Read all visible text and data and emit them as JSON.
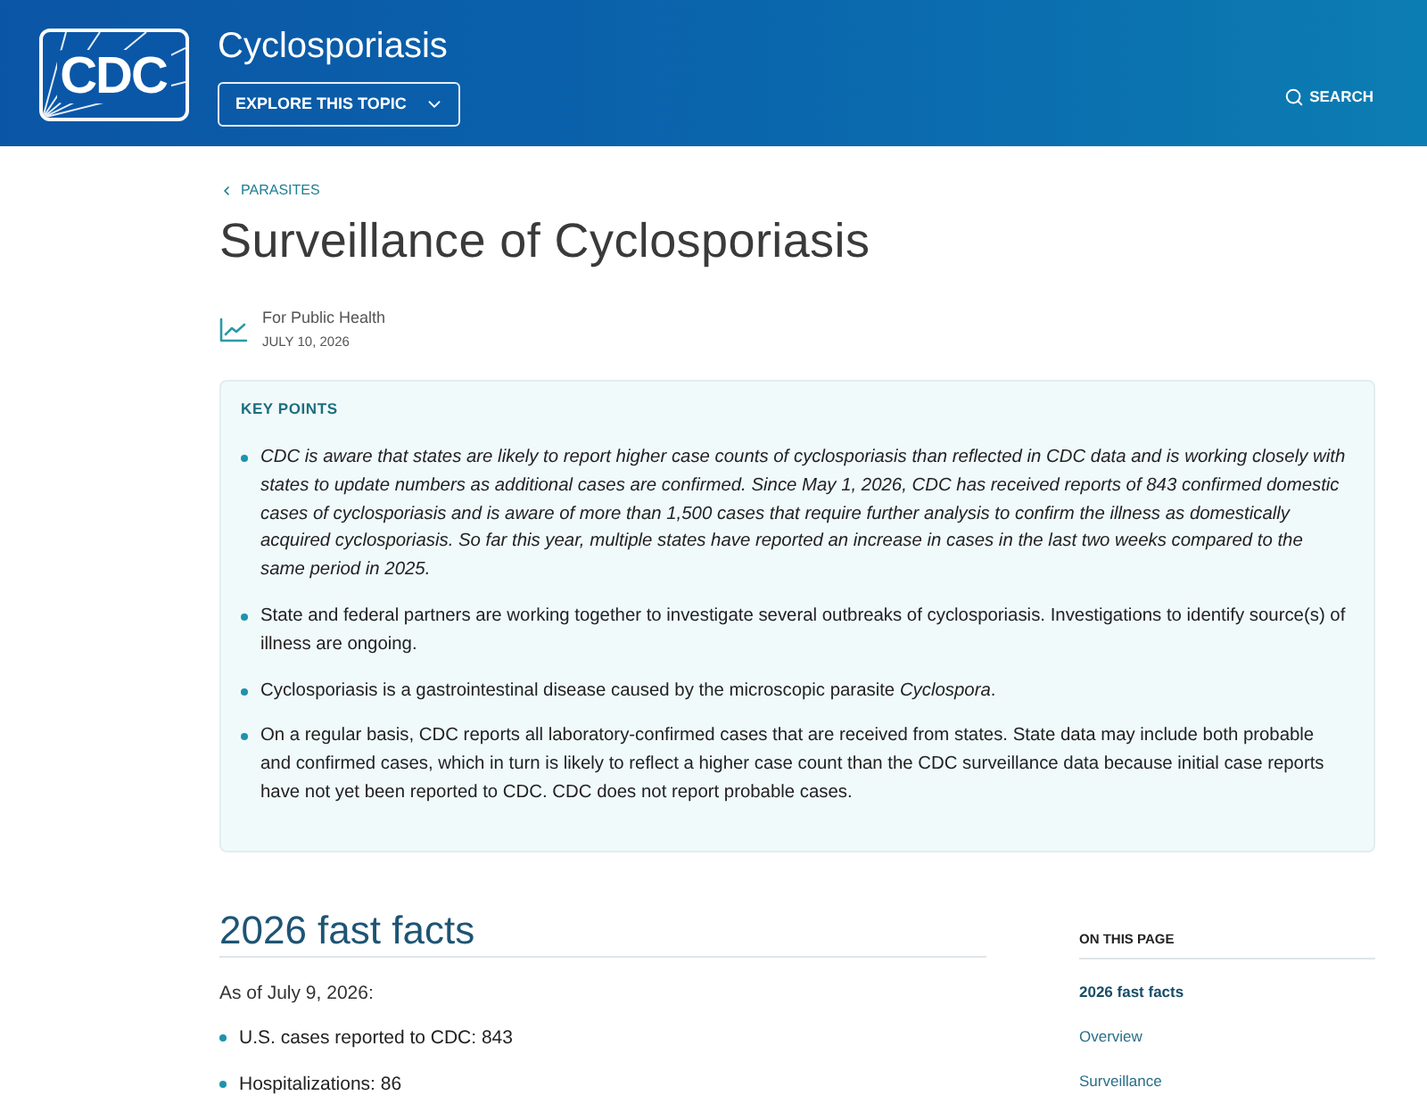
{
  "header": {
    "logo_text": "CDC",
    "title": "Cyclosporiasis",
    "explore_button": "EXPLORE THIS TOPIC",
    "search_label": "SEARCH"
  },
  "breadcrumb": "PARASITES",
  "page_title": "Surveillance of Cyclosporiasis",
  "meta": {
    "audience": "For Public Health",
    "date": "JULY 10, 2026"
  },
  "key_points": {
    "heading": "KEY POINTS",
    "items": [
      {
        "kind": "emphasis",
        "text": "CDC is aware that states are likely to report higher case counts of cyclosporiasis than reflected in CDC data and is working closely with states to update numbers as additional cases are confirmed. Since May 1, 2026, CDC has received reports of 843 confirmed domestic cases of cyclosporiasis and is aware of more than 1,500 cases that require further analysis to confirm the illness as domestically acquired cyclosporiasis. So far this year, multiple states have reported an increase in cases in the last two weeks compared to the same period in 2025."
      },
      {
        "kind": "plain",
        "text": "State and federal partners are working together to investigate several outbreaks of cyclosporiasis. Investigations to identify source(s) of illness are ongoing."
      },
      {
        "kind": "plain",
        "text": "Cyclosporiasis is a gastrointestinal disease caused by the microscopic parasite *Cyclospora*."
      },
      {
        "kind": "plain",
        "text": "On a regular basis, CDC reports all laboratory-confirmed cases that are received from states. State data may include both probable and confirmed cases, which in turn is likely to reflect a higher case count than the CDC surveillance data because initial case reports have not yet been reported to CDC. CDC does not report probable cases."
      }
    ]
  },
  "fast_facts": {
    "heading": "2026 fast facts",
    "intro": "As of July 9, 2026:",
    "items": [
      "U.S. cases reported to CDC: 843",
      "Hospitalizations: 86"
    ]
  },
  "on_this_page": {
    "heading": "ON THIS PAGE",
    "items": [
      {
        "label": "2026 fast facts",
        "selected": true
      },
      {
        "label": "Overview",
        "selected": false
      },
      {
        "label": "Surveillance",
        "selected": false
      }
    ]
  }
}
